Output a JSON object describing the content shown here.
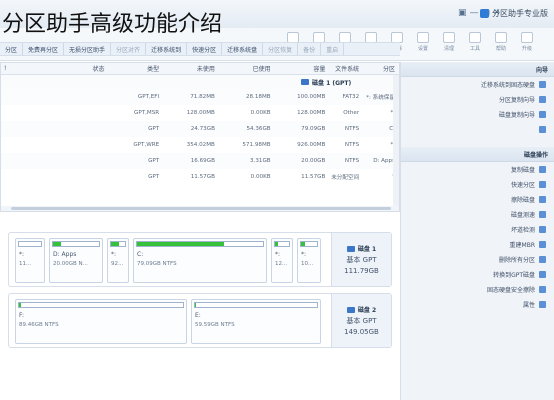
{
  "overlay_title": "分区助手高级功能介绍",
  "app": {
    "title": "分区助手专业版"
  },
  "window_controls": [
    "▣",
    "—",
    "▢",
    "✕"
  ],
  "toolbar": [
    "升级",
    "注册",
    "激活",
    "新建",
    "删除",
    "设置",
    "清理",
    "工具",
    "帮助",
    "升级"
  ],
  "actionbar": [
    {
      "label": "分区",
      "disabled": false
    },
    {
      "label": "免费再分区",
      "disabled": false
    },
    {
      "label": "无损分区助手",
      "disabled": false
    },
    {
      "label": "分区对齐",
      "disabled": true
    },
    {
      "label": "迁移系统到",
      "disabled": false
    },
    {
      "label": "快速分区",
      "disabled": false
    },
    {
      "label": "迁移系统盘",
      "disabled": false
    },
    {
      "label": "分区恢复",
      "disabled": true
    },
    {
      "label": "备份",
      "disabled": true
    },
    {
      "label": "重启",
      "disabled": true
    }
  ],
  "table": {
    "headers": [
      "分区",
      "文件系统",
      "容量",
      "已使用",
      "未使用",
      "类型",
      "状态"
    ],
    "disk_label": "磁盘 1 (GPT)",
    "rows": [
      [
        "*: 系统保留",
        "FAT32",
        "100.00MB",
        "28.18MB",
        "71.82MB",
        "GPT,EFI",
        ""
      ],
      [
        "*:",
        "Other",
        "128.00MB",
        "0.00KB",
        "128.00MB",
        "GPT,MSR",
        ""
      ],
      [
        "C:",
        "NTFS",
        "79.09GB",
        "54.36GB",
        "24.73GB",
        "GPT",
        ""
      ],
      [
        "*:",
        "NTFS",
        "926.00MB",
        "571.98MB",
        "354.02MB",
        "GPT,WRE",
        ""
      ],
      [
        "D: Apps",
        "NTFS",
        "20.00GB",
        "3.31GB",
        "16.69GB",
        "GPT",
        ""
      ],
      [
        "*",
        "未分配空间",
        "11.57GB",
        "0.00KB",
        "11.57GB",
        "GPT",
        ""
      ]
    ]
  },
  "disk1": {
    "name": "磁盘 1",
    "type": "基本 GPT",
    "size": "111.79GB",
    "partitions": [
      {
        "name": "*:",
        "size": "11...",
        "fill": 0.0,
        "grey": true
      },
      {
        "name": "D: Apps",
        "size": "20.00GB N...",
        "fill": 0.17,
        "grey": false
      },
      {
        "name": "*:",
        "size": "92...",
        "fill": 0.6,
        "grey": false
      },
      {
        "name": "C:",
        "size": "79.09GB NTFS",
        "fill": 0.69,
        "grey": false
      },
      {
        "name": "*:",
        "size": "12...",
        "fill": 0.22,
        "grey": false
      },
      {
        "name": "*:",
        "size": "10...",
        "fill": 0.28,
        "grey": false
      }
    ]
  },
  "disk2": {
    "name": "磁盘 2",
    "type": "基本 GPT",
    "size": "149.05GB",
    "partitions": [
      {
        "name": "F:",
        "size": "89.46GB NTFS",
        "fill": 0.01,
        "grey": false
      },
      {
        "name": "E:",
        "size": "59.59GB NTFS",
        "fill": 0.01,
        "grey": false
      }
    ]
  },
  "sidepanel": {
    "wizard_head": "向导",
    "wizard_items": [
      "迁移系统到固态硬盘",
      "分区复制向导",
      "磁盘复制向导"
    ],
    "ops_head": "磁盘操作",
    "ops_items": [
      "复制磁盘",
      "快速分区",
      "擦除磁盘",
      "磁盘测速",
      "坏道检测",
      "重建MBR",
      "删除所有分区",
      "转换到GPT磁盘",
      "固态硬盘安全擦除",
      "属性"
    ]
  }
}
